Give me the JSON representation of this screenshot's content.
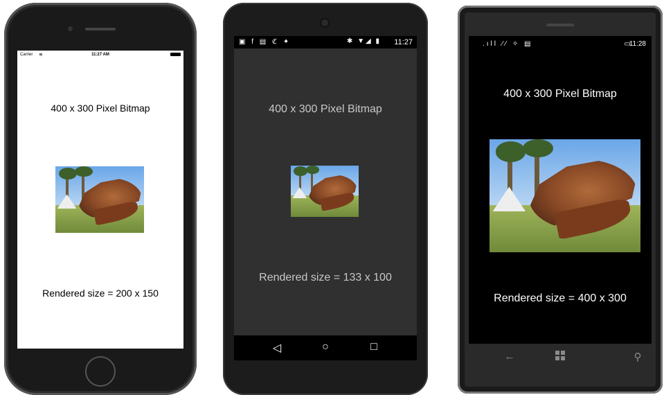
{
  "iphone": {
    "status": {
      "carrier": "Carrier",
      "wifi_icon": "wifi-icon",
      "time": "11:27 AM"
    },
    "title": "400 x 300 Pixel Bitmap",
    "caption": "Rendered size = 200 x 150",
    "bg": "#ffffff"
  },
  "android": {
    "status": {
      "time": "11:27",
      "icons": "notification-icons"
    },
    "title": "400 x 300 Pixel Bitmap",
    "caption": "Rendered size = 133 x 100",
    "nav": {
      "back": "◁",
      "home": "○",
      "recents": "□"
    },
    "bg": "#303030"
  },
  "winphone": {
    "status": {
      "time": "11:28"
    },
    "title": "400 x 300 Pixel Bitmap",
    "caption": "Rendered size = 400 x 300",
    "nav": {
      "back": "←",
      "search": "⚲"
    },
    "bg": "#000000"
  }
}
